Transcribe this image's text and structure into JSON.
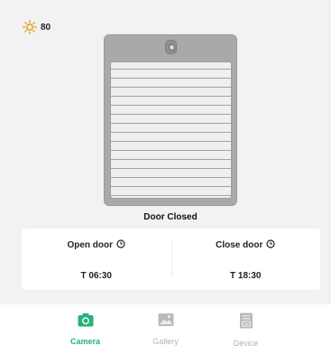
{
  "light": {
    "icon": "sun-icon",
    "value": "80",
    "icon_color": "#e8a31c"
  },
  "door": {
    "status": "Door Closed"
  },
  "schedule": {
    "open": {
      "title": "Open door",
      "time": "T 06:30",
      "icon": "clock-icon"
    },
    "close": {
      "title": "Close door",
      "time": "T 18:30",
      "icon": "clock-icon"
    }
  },
  "tabs": [
    {
      "label": "Camera",
      "icon": "camera-icon",
      "active": true
    },
    {
      "label": "Gallery",
      "icon": "gallery-icon",
      "active": false
    },
    {
      "label": "Device",
      "icon": "device-icon",
      "active": false
    }
  ],
  "colors": {
    "accent": "#25b37b",
    "inactive": "#b3b3b6"
  }
}
